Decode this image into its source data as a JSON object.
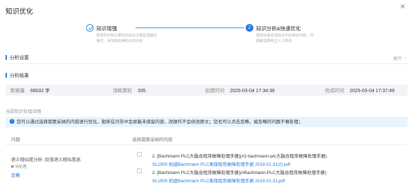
{
  "dialog": {
    "title": "知识优化",
    "close_icon": "close-icon"
  },
  "steps": [
    {
      "index": "1",
      "title": "知识增强",
      "desc_line1": "帮助您的知识更好的适合大模型理解的",
      "desc_line2": "格式，添加缺失等知识的内容"
    },
    {
      "index": "2",
      "title": "知识分析&快速优化",
      "desc_line1": "帮助快速发现知识中的相似问题，同",
      "desc_line2": "期都需要经过人工修改"
    }
  ],
  "analysis_settings": {
    "label": "分析设置",
    "expand_label": "展开",
    "expand_icon": "chevron-down-icon"
  },
  "analysis_results": {
    "label": "分析结果",
    "stats": [
      {
        "key": "数据量",
        "value": "69032 字"
      },
      {
        "key": "消耗算粒",
        "value": "335"
      },
      {
        "key": "创建时间",
        "value": "2025-03-04 17:34:38"
      },
      {
        "key": "完成时间",
        "value": "2025-03-04 17:37:49"
      }
    ]
  },
  "details": {
    "subhead": "当前知识处理详情",
    "notice": "您可以通过选择需要采纳的内容进行优化，勘排在问答中会屏蔽未保留内容，改操作不会修改原文；您也可以点击忽略，被忽略的问题不做处理；",
    "columns": [
      "问题",
      "选择需要采纳的内容"
    ],
    "rows": [
      {
        "question": "语义相似度分析: 段落语义相似度高",
        "status": "待处理",
        "ignore_label": "忽略",
        "options": [
          {
            "title": "2. [Bachmann PLC大融合程序故障处理手册](#2-bachmann-plc大融合程序故障处理手册)",
            "link": "SL1500 机组Bachmann PLC离保程序故障处理手册 2018.01.31(2).pdf"
          },
          {
            "title": "2. [Bachmann PLC大融合程序故障处理手册](#Bachmann-PLC大融合程序故障处理手册)",
            "link": "SL1500 机组Bachmann PLC离保程序故障处理手册 2018.01.31.pdf"
          }
        ]
      }
    ]
  },
  "colors": {
    "accent": "#1f7ae0",
    "notice_bg": "#e9f3fd",
    "stats_bg": "#f3f4f7"
  }
}
